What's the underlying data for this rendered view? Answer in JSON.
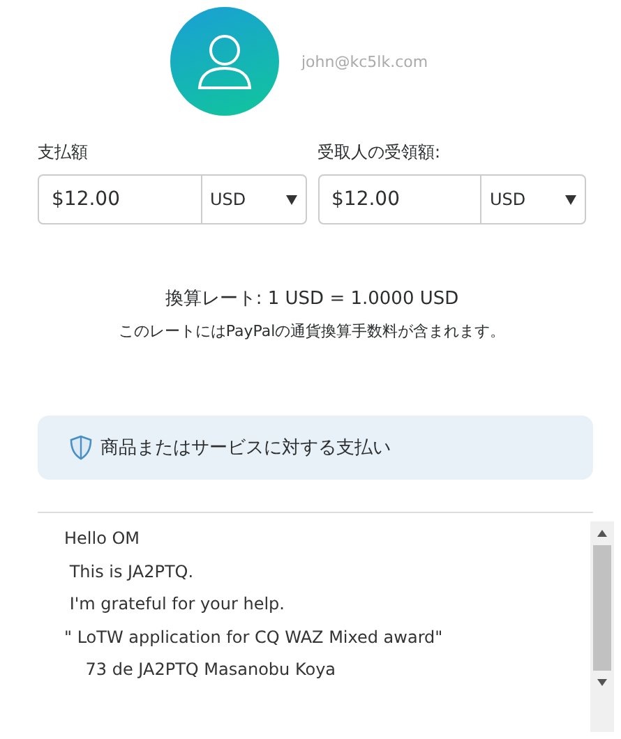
{
  "account": {
    "email": "john@kc5lk.com"
  },
  "amounts": [
    {
      "label": "支払額",
      "value": "$12.00",
      "currency": "USD"
    },
    {
      "label": "受取人の受領額:",
      "value": "$12.00",
      "currency": "USD"
    }
  ],
  "rate": {
    "text": "換算レート: 1 USD = 1.0000 USD",
    "note": "このレートにはPayPalの通貨換算手数料が含まれます。"
  },
  "purpose": {
    "text": "商品またはサービスに対する支払い"
  },
  "message": {
    "value": "Hello OM\n This is JA2PTQ.\n I'm grateful for your help.\n\" LoTW application for CQ WAZ Mixed award\"\n    73 de JA2PTQ Masanobu Koya"
  }
}
